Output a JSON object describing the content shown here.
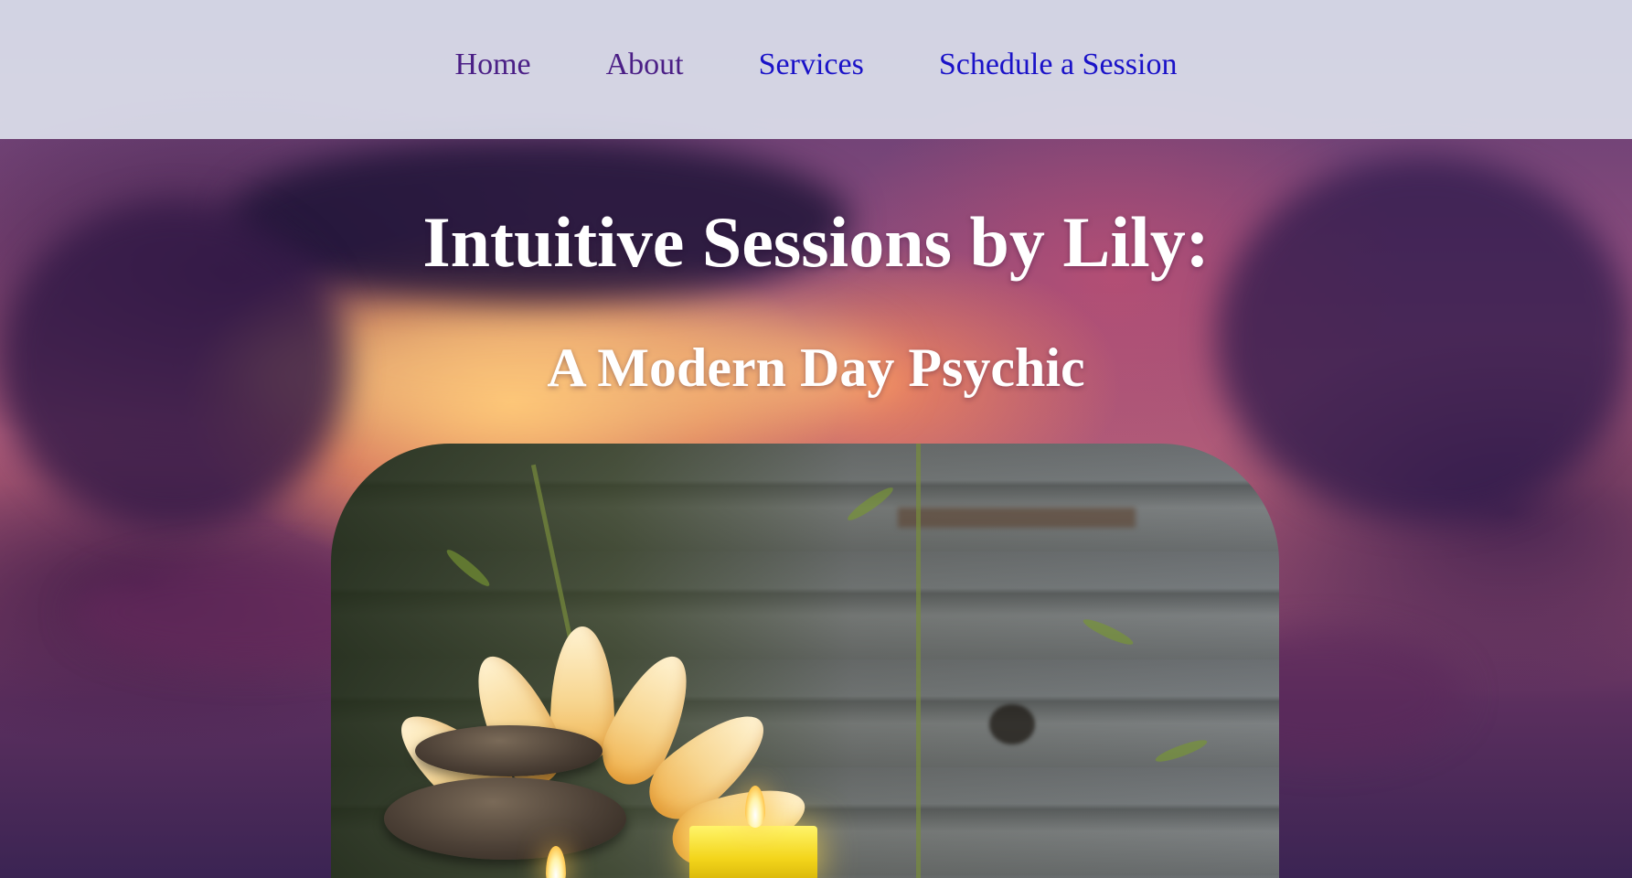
{
  "nav": {
    "items": [
      {
        "label": "Home",
        "state": "visited"
      },
      {
        "label": "About",
        "state": "visited"
      },
      {
        "label": "Services",
        "state": "unvisited"
      },
      {
        "label": "Schedule a Session",
        "state": "unvisited"
      }
    ]
  },
  "hero": {
    "title": "Intuitive Sessions by Lily:",
    "subtitle": "A Modern Day Psychic"
  },
  "colors": {
    "nav_background": "#e2e8f2",
    "nav_link_visited": "#4b1f86",
    "nav_link_unvisited": "#1a12c8",
    "hero_text": "#ffffff"
  }
}
